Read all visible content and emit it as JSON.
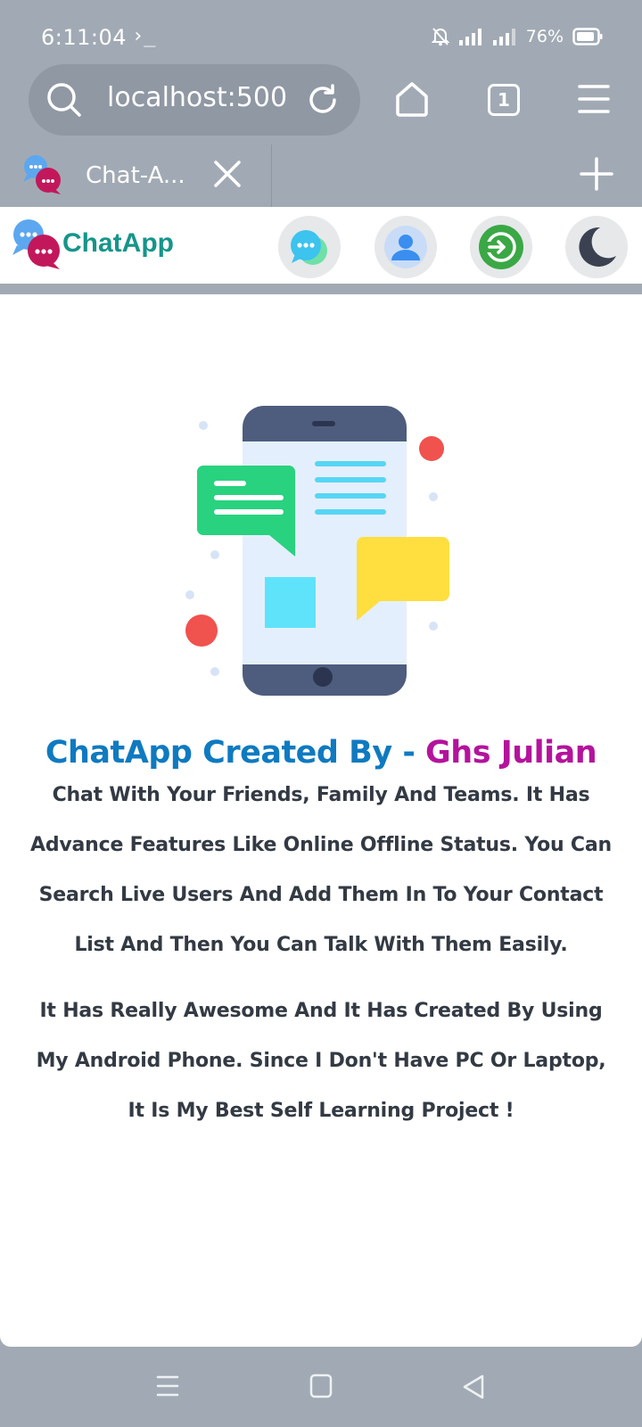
{
  "status_bar": {
    "time": "6:11:04",
    "terminal_glyph": "›_",
    "battery": "76%"
  },
  "browser": {
    "url": "localhost:500",
    "tab_count": "1",
    "tab_title": "Chat-A..."
  },
  "app": {
    "brand": "ChatApp",
    "nav_icons": [
      "chat-bubbles-icon",
      "user-icon",
      "login-icon",
      "dark-mode-moon-icon"
    ],
    "hero_title_part1": "ChatApp Created By - ",
    "hero_title_part2": "Ghs Julian",
    "paragraph1": "Chat With Your Friends, Family And Teams. It Has Advance Features Like Online Offline Status. You Can Search Live Users And Add Them In To Your Contact List And Then You Can Talk With Them Easily.",
    "paragraph2": "It Has Really Awesome And It Has Created By Using My Android Phone. Since I Don't Have PC Or Laptop, It Is My Best Self Learning Project !"
  },
  "colors": {
    "brand": "#16958a",
    "title_blue": "#0f7ac0",
    "title_magenta": "#b4139c",
    "chrome_bg": "#a1aab4"
  }
}
